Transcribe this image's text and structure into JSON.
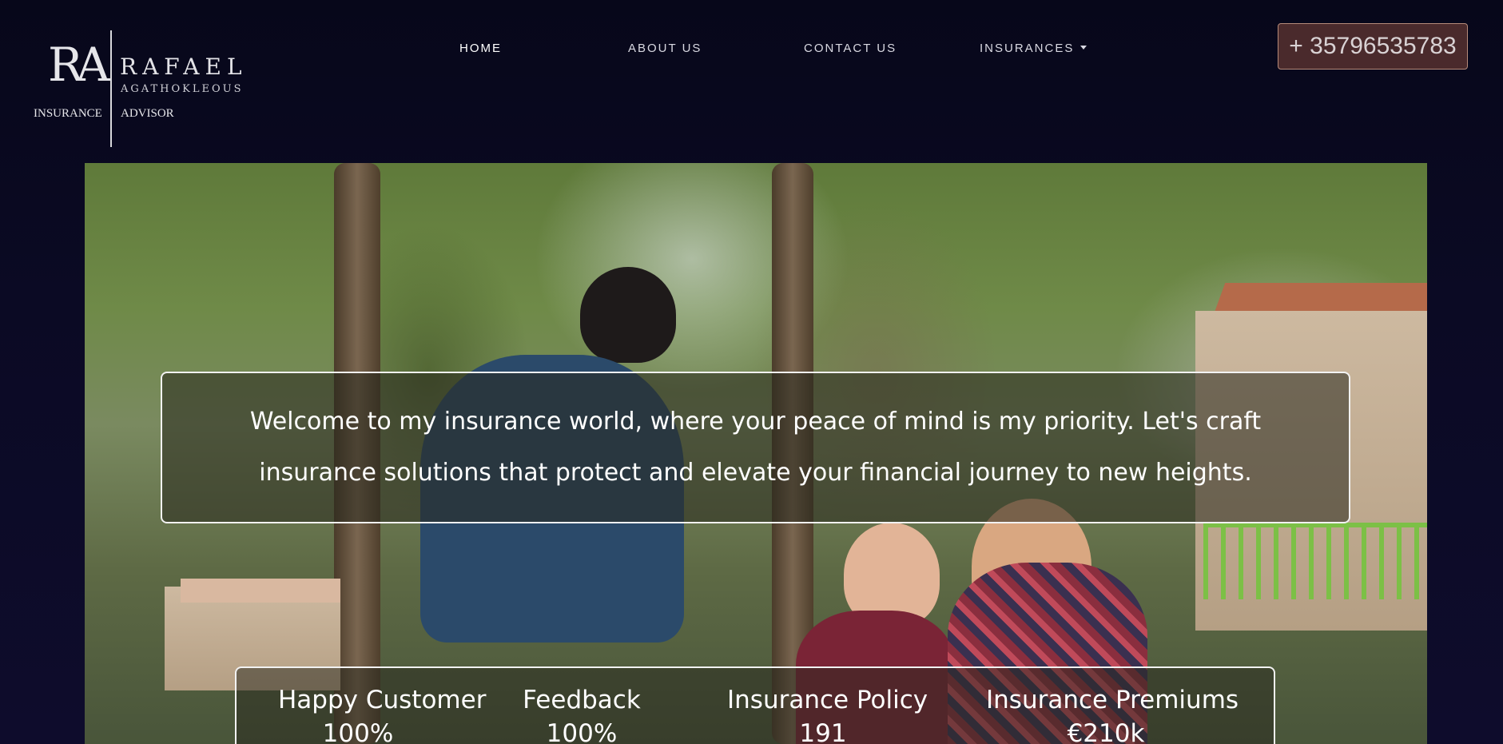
{
  "logo": {
    "monogram": "RA",
    "name": "RAFAEL",
    "surname": "AGATHOKLEOUS",
    "caption_left": "INSURANCE",
    "caption_right": "ADVISOR"
  },
  "nav": {
    "items": [
      {
        "label": "HOME",
        "active": true
      },
      {
        "label": "ABOUT US"
      },
      {
        "label": "CONTACT US"
      },
      {
        "label": "INSURANCES",
        "dropdown": true
      }
    ]
  },
  "header": {
    "phone_label": "+ 35796535783"
  },
  "hero": {
    "welcome_text": "Welcome to my insurance world, where your peace of mind is my priority. Let's craft insurance solutions that protect and elevate your financial journey to new heights.",
    "stats": [
      {
        "label": "Happy Customer",
        "value": "100%"
      },
      {
        "label": "Feedback",
        "value": "100%"
      },
      {
        "label": "Insurance Policy",
        "value": "191"
      },
      {
        "label": "Insurance Premiums",
        "value": "€210k"
      }
    ]
  },
  "colors": {
    "background": "#0b0a24",
    "phone_button_bg": "#4a2a2c",
    "phone_button_border": "#b58a7a"
  }
}
